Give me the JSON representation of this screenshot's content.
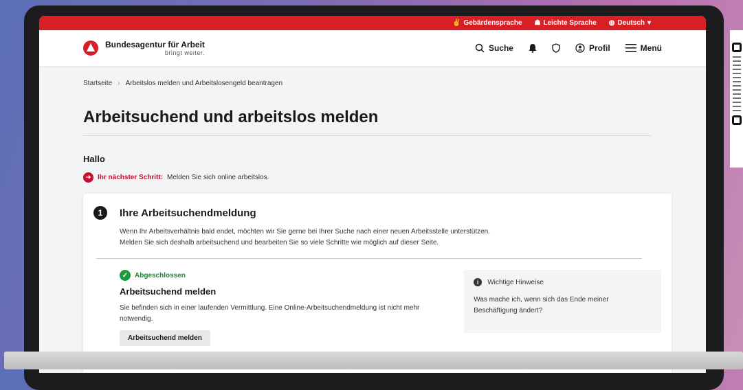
{
  "topbar": {
    "sign_language": "Gebärdensprache",
    "easy_language": "Leichte Sprache",
    "language": "Deutsch"
  },
  "header": {
    "logo_title": "Bundesagentur für Arbeit",
    "logo_tagline": "bringt weiter.",
    "search": "Suche",
    "profile": "Profil",
    "menu": "Menü"
  },
  "breadcrumb": {
    "home": "Startseite",
    "current": "Arbeitslos melden und Arbeitslosengeld beantragen"
  },
  "page_title": "Arbeitsuchend und arbeitslos melden",
  "greeting": "Hallo",
  "next_step": {
    "label": "Ihr nächster Schritt:",
    "text": "Melden Sie sich online arbeitslos."
  },
  "card": {
    "number": "1",
    "title": "Ihre Arbeitsuchendmeldung",
    "text_line1": "Wenn Ihr Arbeitsverhältnis bald endet, möchten wir Sie gerne bei Ihrer Suche nach einer neuen Arbeitsstelle unterstützen.",
    "text_line2": "Melden Sie sich deshalb arbeitsuchend und bearbeiten Sie so viele Schritte wie möglich auf dieser Seite.",
    "status": "Abgeschlossen",
    "sub_title": "Arbeitsuchend melden",
    "sub_text": "Sie befinden sich in einer laufenden Vermittlung. Eine Online-Arbeitsuchendmeldung ist nicht mehr notwendig.",
    "button": "Arbeitsuchend melden",
    "hint_title": "Wichtige Hinweise",
    "hint_text": "Was mache ich, wenn sich das Ende meiner Beschäftigung ändert?"
  },
  "colors": {
    "brand_red": "#d81f26",
    "success_green": "#1e9a3a"
  }
}
